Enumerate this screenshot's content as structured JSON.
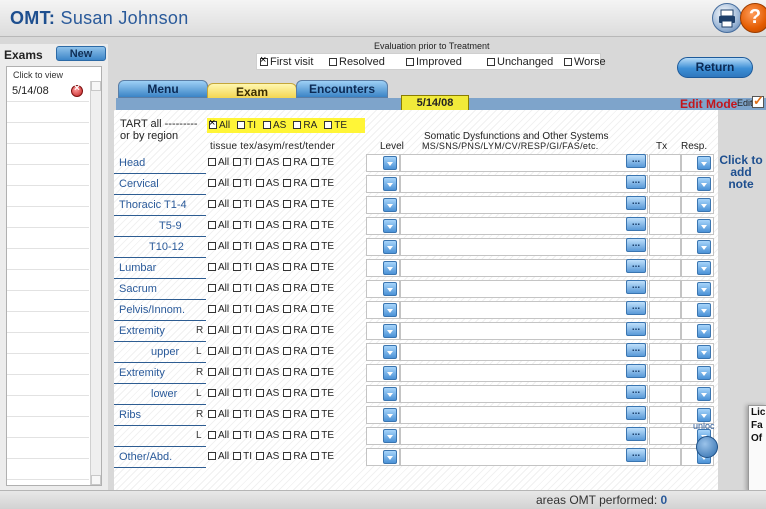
{
  "header": {
    "app_name": "OMT:",
    "patient_name": "Susan Johnson"
  },
  "sidebar": {
    "exams_label": "Exams",
    "new_label": "New",
    "click_to_view": "Click to view",
    "exams": [
      {
        "date": "5/14/08"
      }
    ]
  },
  "evaluation": {
    "title": "Evaluation prior to Treatment",
    "options": [
      {
        "label": "First visit",
        "checked": true
      },
      {
        "label": "Resolved",
        "checked": false
      },
      {
        "label": "Improved",
        "checked": false
      },
      {
        "label": "Unchanged",
        "checked": false
      },
      {
        "label": "Worse",
        "checked": false
      }
    ]
  },
  "return_label": "Return",
  "tabs": {
    "menu": "Menu",
    "exam": "Exam",
    "encounters": "Encounters"
  },
  "exam_date": "5/14/08",
  "edit_mode": {
    "label": "Edit Mode",
    "edit_label": "Edit",
    "checked": true
  },
  "tart": {
    "label_all": "TART all ---------",
    "label_region": "or by region",
    "all_options": [
      {
        "label": "All",
        "checked": true
      },
      {
        "label": "TI",
        "checked": false
      },
      {
        "label": "AS",
        "checked": false
      },
      {
        "label": "RA",
        "checked": false
      },
      {
        "label": "TE",
        "checked": false
      }
    ]
  },
  "columns": {
    "tissue": "tissue tex/asym/rest/tender",
    "level": "Level",
    "somatic_title": "Somatic Dysfunctions and Other Systems",
    "somatic_sub": "MS/SNS/PNS/LYM/CV/RESP/GI/FAS/etc.",
    "tx": "Tx",
    "resp": "Resp."
  },
  "tart_labels": [
    "All",
    "TI",
    "AS",
    "RA",
    "TE"
  ],
  "more_label": "...",
  "rows": [
    {
      "region": "Head",
      "side": ""
    },
    {
      "region": "Cervical",
      "side": ""
    },
    {
      "region": "Thoracic T1-4",
      "side": ""
    },
    {
      "region": "T5-9",
      "side": ""
    },
    {
      "region": "T10-12",
      "side": ""
    },
    {
      "region": "Lumbar",
      "side": ""
    },
    {
      "region": "Sacrum",
      "side": ""
    },
    {
      "region": "Pelvis/Innom.",
      "side": ""
    },
    {
      "region": "Extremity",
      "side": "R"
    },
    {
      "region": "upper",
      "side": "L"
    },
    {
      "region": "Extremity",
      "side": "R"
    },
    {
      "region": "lower",
      "side": "L"
    },
    {
      "region": "Ribs",
      "side": "R"
    },
    {
      "region": "",
      "side": "L"
    },
    {
      "region": "Other/Abd.",
      "side": ""
    }
  ],
  "click_to_add_note": "Click to add note",
  "unlock_label": "unloc",
  "popup_lines": [
    "Lic",
    "Fa",
    "Of"
  ],
  "footer": {
    "label": "areas OMT performed:",
    "count": "0"
  },
  "icons": {
    "printer": "printer-icon",
    "help": "help-icon",
    "delete": "delete-icon",
    "dropdown": "dropdown-arrow-icon"
  },
  "colors": {
    "accent_blue": "#2a5a9a",
    "exam_tab": "#f2d34b",
    "edit_mode": "#c4161c",
    "date_badge": "#f1ea3a"
  }
}
